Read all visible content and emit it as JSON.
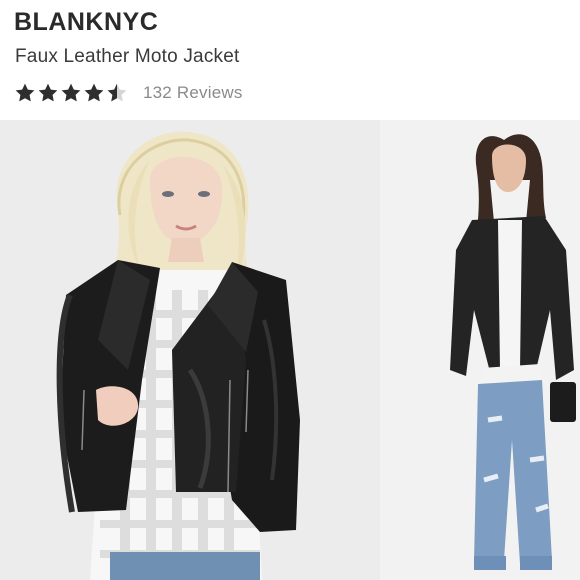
{
  "listing": {
    "brand": "BLANKNYC",
    "title": "Faux Leather Moto Jacket",
    "rating": 4.5,
    "rating_max": 5,
    "reviews_label": "132 Reviews"
  },
  "colors": {
    "star_fill": "#2e2e2e",
    "star_empty": "#d6d6d6",
    "brand_text": "#2a2a2a",
    "meta_text": "#8a8a8a",
    "gallery_bg": "#ebebeb"
  },
  "gallery": {
    "images": [
      {
        "name": "model-front-view"
      },
      {
        "name": "model-full-length-view"
      }
    ]
  }
}
